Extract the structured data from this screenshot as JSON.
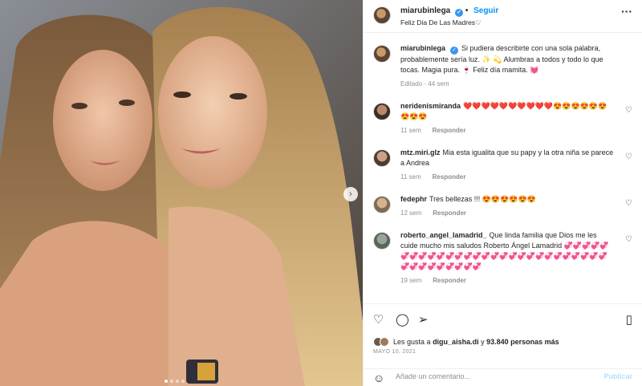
{
  "photo": {
    "alt": "Foto de dos mujeres con cabello rubio rizado"
  },
  "header": {
    "username": "miarubinlega",
    "follow_label": "Seguir",
    "location": "Feliz Dia De Las Madres♡",
    "more_icon": "more-horizontal-icon"
  },
  "caption": {
    "username": "miarubinlega",
    "text": "Si pudiera describirte con una sola palabra, probablemente sería luz. ✨ 💫 Alumbras a todos y todo lo que tocas. Magia pura. 🍷 Feliz día mamita. 💓",
    "meta": "Editado · 44 sem"
  },
  "comments": [
    {
      "username": "neridenismiranda",
      "text": "❤️❤️❤️❤️❤️❤️❤️❤️❤️❤️😍😍😍😍😍😍😍😍😍",
      "time": "11 sem",
      "reply": "Responder"
    },
    {
      "username": "mtz.miri.glz",
      "text": "Mia esta igualita que su papy y la otra niña se parece a Andrea",
      "time": "11 sem",
      "reply": "Responder"
    },
    {
      "username": "fedephr",
      "text": "Tres bellezas !!! 😍😍😍😍😍😍",
      "time": "12 sem",
      "reply": "Responder"
    },
    {
      "username": "roberto_angel_lamadrid_",
      "text": "Que linda familia que Dios me les cuide mucho mis saludos Roberto Ángel Lamadrid 💞💞💞💞💞💞💞💞💞💞💞💞💞💞💞💞💞💞💞💞💞💞💞💞💞💞💞💞💞💞💞💞💞💞💞💞💞",
      "time": "19 sem",
      "reply": "Responder"
    }
  ],
  "actions": {
    "like_icon": "heart-icon",
    "comment_icon": "comment-icon",
    "share_icon": "share-icon",
    "save_icon": "bookmark-icon"
  },
  "likes": {
    "prefix": "Les gusta a",
    "user": "digu_aisha.di",
    "middle": "y",
    "count": "93.840 personas más"
  },
  "date": "MAYO 10, 2021",
  "add_comment": {
    "placeholder": "Añade un comentario...",
    "post_label": "Publicar"
  },
  "colors": {
    "link_blue": "#0095f6",
    "verified_blue": "#3897f0",
    "muted": "#8e8e8e"
  }
}
